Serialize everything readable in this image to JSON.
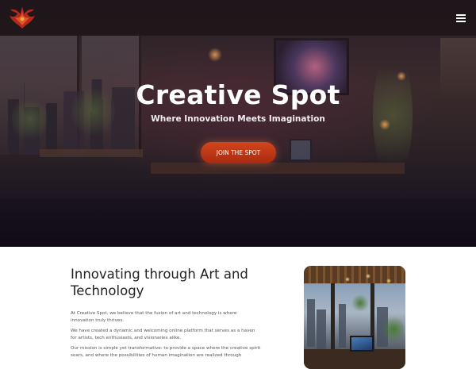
{
  "header": {
    "logo_icon": "phoenix-logo-icon",
    "menu_icon": "hamburger-menu-icon"
  },
  "hero": {
    "title": "Creative Spot",
    "subtitle": "Where Innovation Meets Imagination",
    "cta_label": "JOIN THE SPOT",
    "cta_color": "#c23a17"
  },
  "about": {
    "title": "Innovating through Art and Technology",
    "paragraphs": [
      "At Creative Spot, we believe that the fusion of art and technology is where innovation truly thrives.",
      "We have created a dynamic and welcoming online platform that serves as a haven for artists, tech enthusiasts, and visionaries alike.",
      "Our mission is simple yet transformative: to provide a space where the creative spirit soars, and where the possibilities of human imagination are realized through"
    ],
    "image_icon": "creative-workspace-photo"
  }
}
